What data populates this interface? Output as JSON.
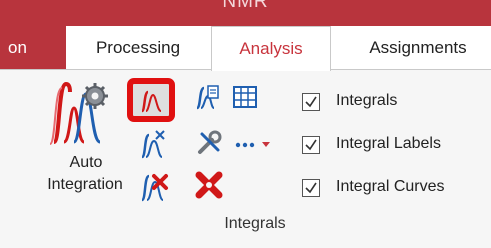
{
  "app": {
    "title": "NMR"
  },
  "tabs": [
    {
      "label": "on",
      "state": "partial"
    },
    {
      "label": "Processing",
      "state": "normal"
    },
    {
      "label": "Analysis",
      "state": "active"
    },
    {
      "label": "Assignments",
      "state": "normal"
    }
  ],
  "integrals_group": {
    "label": "Integrals",
    "auto_integration": {
      "line1": "Auto",
      "line2": "Integration",
      "icon": "auto-integration-icon"
    },
    "tools": [
      {
        "icon": "manual-integration-icon",
        "highlighted": true
      },
      {
        "icon": "integral-edit-icon"
      },
      {
        "icon": "integral-table-icon"
      },
      {
        "icon": "integral-split-icon"
      },
      {
        "icon": "integral-settings-icon"
      },
      {
        "icon": "more-options-icon"
      },
      {
        "icon": "integral-delete-icon"
      },
      {
        "icon": "integral-clear-icon"
      }
    ],
    "options": [
      {
        "label": "Integrals",
        "checked": true
      },
      {
        "label": "Integral Labels",
        "checked": true
      },
      {
        "label": "Integral Curves",
        "checked": true
      }
    ]
  },
  "colors": {
    "titlebar": "#b8343d",
    "active_tab_text": "#c8343d",
    "highlight_border": "#e01010",
    "integral_red": "#d01818",
    "integral_blue": "#1f5fb0"
  }
}
